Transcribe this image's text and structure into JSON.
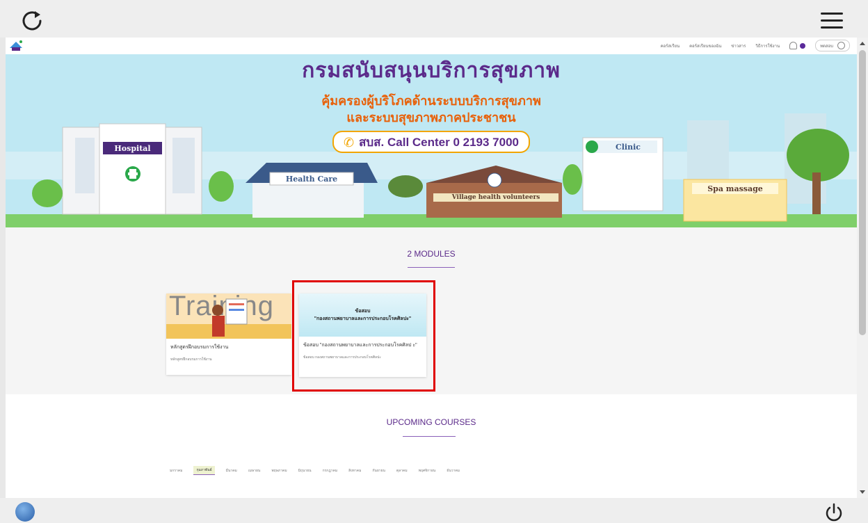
{
  "header": {
    "nav_items": [
      "คอร์สเรียน",
      "คอร์สเรียนของฉัน",
      "ข่าวสาร",
      "วิธีการใช้งาน"
    ],
    "profile_label": "ทดสอบ"
  },
  "hero": {
    "title": "กรมสนับสนุนบริการสุขภาพ",
    "subtitle_line1": "คุ้มครองผู้บริโภคด้านระบบบริการสุขภาพ",
    "subtitle_line2": "และระบบสุขภาพภาคประชาชน",
    "call_center": "สบส. Call Center 0 2193 7000",
    "signs": [
      "Hospital",
      "Health Care",
      "Village health volunteers",
      "Clinic",
      "Spa massage"
    ]
  },
  "modules": {
    "heading": "2 MODULES",
    "cards": [
      {
        "thumb_text": "Training",
        "title": "หลักสูตรฝึกอบรมการใช้งาน",
        "subtitle": "หลักสูตรฝึกอบรมการใช้งาน"
      },
      {
        "thumb_line1": "ข้อสอบ",
        "thumb_line2": "\"กองสถานพยาบาลและการประกอบโรคศิลปะ\"",
        "title": "ข้อสอบ \"กองสถานพยาบาลและการประกอบโรคศิลป ะ\"",
        "subtitle": "ข้อสอบ กองสถานพยาบาลและการประกอบโรคศิลปะ"
      }
    ]
  },
  "upcoming": {
    "heading": "UPCOMING COURSES",
    "tabs": [
      "มกราคม",
      "กุมภาพันธ์",
      "มีนาคม",
      "เมษายน",
      "พฤษภาคม",
      "มิถุนายน",
      "กรกฎาคม",
      "สิงหาคม",
      "กันยายน",
      "ตุลาคม",
      "พฤศจิกายน",
      "ธันวาคม"
    ],
    "active_tab": 1
  },
  "colors": {
    "brand_purple": "#5b2a8a",
    "hero_orange": "#e8610a",
    "highlight_red": "#e00000"
  }
}
